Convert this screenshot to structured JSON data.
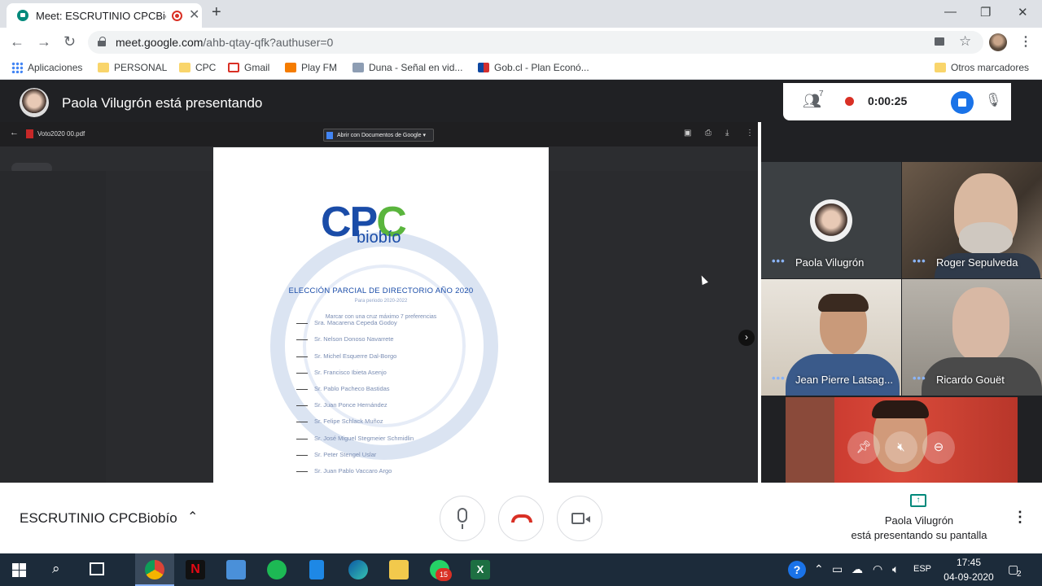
{
  "browser": {
    "tab_title": "Meet: ESCRUTINIO CPCBiobío",
    "url_host": "meet.google.com",
    "url_path": "/ahb-qtay-qfk?authuser=0",
    "bookmarks": [
      "Aplicaciones",
      "PERSONAL",
      "CPC",
      "Gmail",
      "Play FM",
      "Duna - Señal en vid...",
      "Gob.cl - Plan Econó...",
      "Otros marcadores"
    ]
  },
  "meet": {
    "presenter_banner": "Paola Vilugrón está presentando",
    "participant_count": "7",
    "recording_time": "0:00:25",
    "meeting_name": "ESCRUTINIO CPCBiobío",
    "presenting_line1": "Paola Vilugrón",
    "presenting_line2": "está presentando su pantalla",
    "tiles": [
      {
        "name": "Paola Vilugrón"
      },
      {
        "name": "Roger Sepulveda"
      },
      {
        "name": "Jean Pierre Latsag..."
      },
      {
        "name": "Ricardo Gouët"
      }
    ]
  },
  "presentation": {
    "pdf_filename": "Voto2020 00.pdf",
    "open_with_button": "Abrir con Documentos de Google",
    "logo_text_a": "CP",
    "logo_text_b": "C",
    "logo_sub": "biobío",
    "heading": "ELECCIÓN PARCIAL DE DIRECTORIO AÑO 2020",
    "period": "Para periodo 2020-2022",
    "instruction": "Marcar con una cruz máximo 7 preferencias",
    "candidates": [
      "Sra. Macarena Cepeda Godoy",
      "Sr. Nelson Donoso Navarrete",
      "Sr. Michel Esquerre Dal-Borgo",
      "Sr. Francisco Ibieta Asenjo",
      "Sr. Pablo Pacheco Bastidas",
      "Sr. Juan Ponce Hernández",
      "Sr. Felipe Schlack Muñoz",
      "Sr. José Miguel Stegmeier Schmidlin",
      "Sr. Peter Stengel Uslar",
      "Sr. Juan Pablo Vaccaro Argo"
    ]
  },
  "taskbar": {
    "language": "ESP",
    "time": "17:45",
    "date": "04-09-2020",
    "whatsapp_badge": "15",
    "notifications": "2"
  },
  "colors": {
    "meet_dark": "#202124",
    "record_red": "#d93025",
    "accent_blue": "#1a73e8",
    "present_teal": "#00897b"
  }
}
